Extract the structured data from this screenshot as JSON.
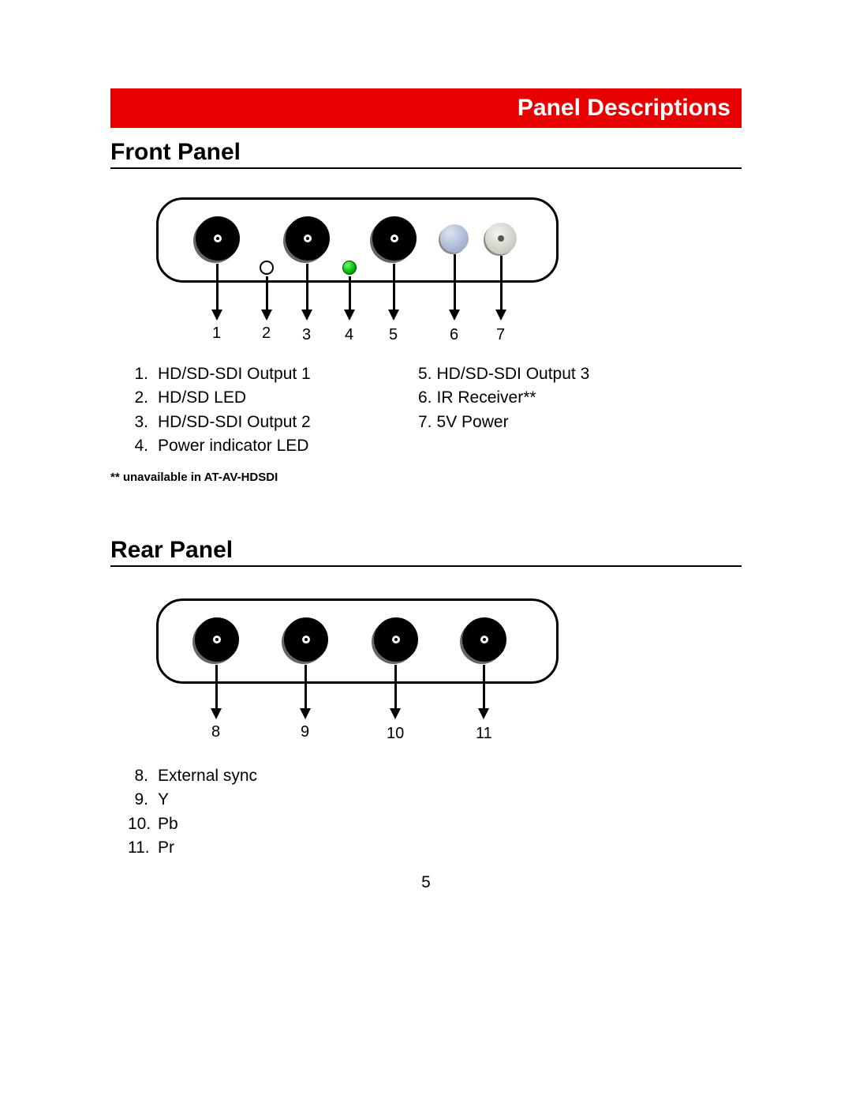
{
  "header": "Panel Descriptions",
  "front": {
    "title": "Front Panel",
    "callouts": [
      "1",
      "2",
      "3",
      "4",
      "5",
      "6",
      "7"
    ],
    "items_left": [
      {
        "n": "1.",
        "t": "HD/SD-SDI Output 1"
      },
      {
        "n": "2.",
        "t": "HD/SD LED"
      },
      {
        "n": "3.",
        "t": "HD/SD-SDI Output 2"
      },
      {
        "n": "4.",
        "t": "Power indicator LED"
      }
    ],
    "items_right": [
      {
        "n": "5.",
        "t": "HD/SD-SDI Output 3"
      },
      {
        "n": "6.",
        "t": "IR Receiver**"
      },
      {
        "n": "7.",
        "t": "5V Power"
      }
    ]
  },
  "footnote": "** unavailable in AT-AV-HDSDI",
  "rear": {
    "title": "Rear Panel",
    "callouts": [
      "8",
      "9",
      "10",
      "11"
    ],
    "items": [
      {
        "n": "8.",
        "t": "External sync"
      },
      {
        "n": "9.",
        "t": "Y"
      },
      {
        "n": "10.",
        "t": "Pb"
      },
      {
        "n": "11.",
        "t": "Pr"
      }
    ]
  },
  "page_number": "5"
}
